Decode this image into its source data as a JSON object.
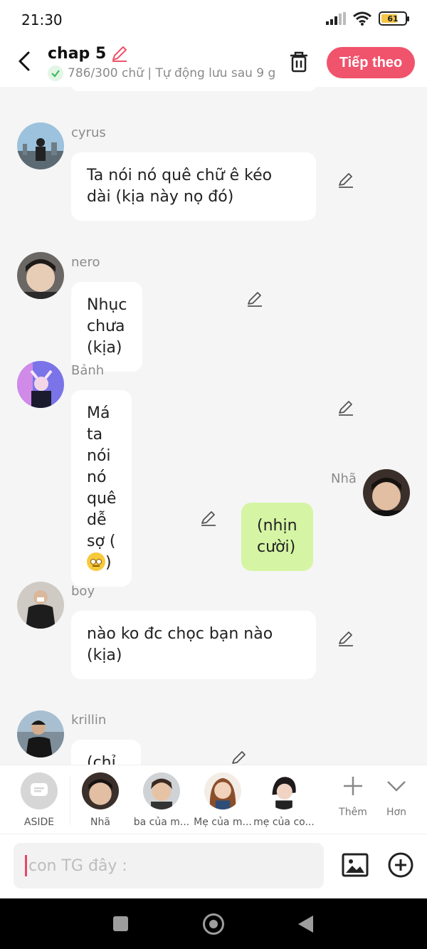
{
  "status_bar": {
    "time": "21:30",
    "battery": "61",
    "battery_level": 0.61
  },
  "header": {
    "title": "chap 5",
    "subtitle": "786/300 chữ | Tự động lưu sau 9 g",
    "next_label": "Tiếp theo"
  },
  "messages": [
    {
      "name": "cyrus",
      "text": "Ta nói nó quê chữ ê kéo dài (kịa này nọ đó)"
    },
    {
      "name": "nero",
      "text": "Nhục chưa (kịa)"
    },
    {
      "name": "Bảnh",
      "text_before": "Má ta nói nó quê dễ sợ (",
      "emoji": "eye-roll-emoji",
      "text_after": ")"
    },
    {
      "name": "Nhã",
      "text": "(nhịn cười)",
      "mine": true
    },
    {
      "name": "boy",
      "text": "nào ko đc chọc bạn nào (kịa)"
    },
    {
      "name": "krillin",
      "text": "(chỉ biết cười)"
    }
  ],
  "characters": [
    {
      "label": "ASIDE"
    },
    {
      "label": "Nhã"
    },
    {
      "label": "ba của m..."
    },
    {
      "label": "Mẹ của m..."
    },
    {
      "label": "mẹ của co..."
    }
  ],
  "tools": {
    "more_label": "Thêm",
    "expand_label": "Hơn"
  },
  "input": {
    "placeholder": "con TG đây :"
  },
  "colors": {
    "accent": "#f0536c",
    "my_bubble": "#d5f5a4",
    "background": "#f5f5f5"
  }
}
